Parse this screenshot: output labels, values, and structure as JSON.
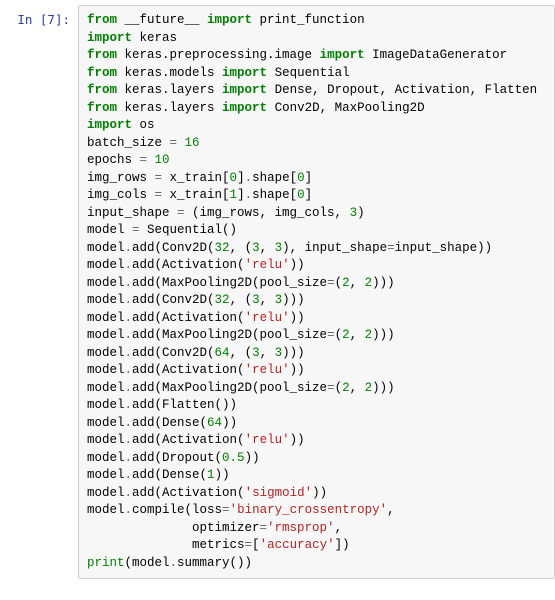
{
  "cell": {
    "prompt_label": "In [7]:",
    "code": {
      "l01a": "from",
      "l01b": " __future__ ",
      "l01c": "import",
      "l01d": " print_function",
      "l02a": "import",
      "l02b": " keras",
      "l03a": "from",
      "l03b": " keras.preprocessing.image ",
      "l03c": "import",
      "l03d": " ImageDataGenerator",
      "l04a": "from",
      "l04b": " keras.models ",
      "l04c": "import",
      "l04d": " Sequential",
      "l05a": "from",
      "l05b": " keras.layers ",
      "l05c": "import",
      "l05d": " Dense, Dropout, Activation, Flatten",
      "l06a": "from",
      "l06b": " keras.layers ",
      "l06c": "import",
      "l06d": " Conv2D, MaxPooling2D",
      "l07a": "import",
      "l07b": " os",
      "l08": "",
      "l09a": "batch_size ",
      "l09b": "=",
      "l09c": " ",
      "l09d": "16",
      "l10a": "epochs ",
      "l10b": "=",
      "l10c": " ",
      "l10d": "10",
      "l11": "",
      "l12a": "img_rows ",
      "l12b": "=",
      "l12c": " x_train[",
      "l12d": "0",
      "l12e": "]",
      "l12f": ".",
      "l12g": "shape[",
      "l12h": "0",
      "l12i": "]",
      "l13a": "img_cols ",
      "l13b": "=",
      "l13c": " x_train[",
      "l13d": "1",
      "l13e": "]",
      "l13f": ".",
      "l13g": "shape[",
      "l13h": "0",
      "l13i": "]",
      "l14a": "input_shape ",
      "l14b": "=",
      "l14c": " (img_rows, img_cols, ",
      "l14d": "3",
      "l14e": ")",
      "l15": "",
      "l16a": "model ",
      "l16b": "=",
      "l16c": " Sequential()",
      "l17a": "model",
      "l17b": ".",
      "l17c": "add(Conv2D(",
      "l17d": "32",
      "l17e": ", (",
      "l17f": "3",
      "l17g": ", ",
      "l17h": "3",
      "l17i": "), input_shape",
      "l17j": "=",
      "l17k": "input_shape))",
      "l18a": "model",
      "l18b": ".",
      "l18c": "add(Activation(",
      "l18d": "'relu'",
      "l18e": "))",
      "l19a": "model",
      "l19b": ".",
      "l19c": "add(MaxPooling2D(pool_size",
      "l19d": "=",
      "l19e": "(",
      "l19f": "2",
      "l19g": ", ",
      "l19h": "2",
      "l19i": ")))",
      "l20": "",
      "l21a": "model",
      "l21b": ".",
      "l21c": "add(Conv2D(",
      "l21d": "32",
      "l21e": ", (",
      "l21f": "3",
      "l21g": ", ",
      "l21h": "3",
      "l21i": ")))",
      "l22a": "model",
      "l22b": ".",
      "l22c": "add(Activation(",
      "l22d": "'relu'",
      "l22e": "))",
      "l23a": "model",
      "l23b": ".",
      "l23c": "add(MaxPooling2D(pool_size",
      "l23d": "=",
      "l23e": "(",
      "l23f": "2",
      "l23g": ", ",
      "l23h": "2",
      "l23i": ")))",
      "l24": "",
      "l25a": "model",
      "l25b": ".",
      "l25c": "add(Conv2D(",
      "l25d": "64",
      "l25e": ", (",
      "l25f": "3",
      "l25g": ", ",
      "l25h": "3",
      "l25i": ")))",
      "l26a": "model",
      "l26b": ".",
      "l26c": "add(Activation(",
      "l26d": "'relu'",
      "l26e": "))",
      "l27a": "model",
      "l27b": ".",
      "l27c": "add(MaxPooling2D(pool_size",
      "l27d": "=",
      "l27e": "(",
      "l27f": "2",
      "l27g": ", ",
      "l27h": "2",
      "l27i": ")))",
      "l28": "",
      "l29a": "model",
      "l29b": ".",
      "l29c": "add(Flatten())",
      "l30a": "model",
      "l30b": ".",
      "l30c": "add(Dense(",
      "l30d": "64",
      "l30e": "))",
      "l31a": "model",
      "l31b": ".",
      "l31c": "add(Activation(",
      "l31d": "'relu'",
      "l31e": "))",
      "l32a": "model",
      "l32b": ".",
      "l32c": "add(Dropout(",
      "l32d": "0.5",
      "l32e": "))",
      "l33a": "model",
      "l33b": ".",
      "l33c": "add(Dense(",
      "l33d": "1",
      "l33e": "))",
      "l34a": "model",
      "l34b": ".",
      "l34c": "add(Activation(",
      "l34d": "'sigmoid'",
      "l34e": "))",
      "l35": "",
      "l36a": "model",
      "l36b": ".",
      "l36c": "compile(loss",
      "l36d": "=",
      "l36e": "'binary_crossentropy'",
      "l36f": ",",
      "l37a": "              optimizer",
      "l37b": "=",
      "l37c": "'rmsprop'",
      "l37d": ",",
      "l38a": "              metrics",
      "l38b": "=",
      "l38c": "[",
      "l38d": "'accuracy'",
      "l38e": "])",
      "l39": "",
      "l40a": "print",
      "l40b": "(model",
      "l40c": ".",
      "l40d": "summary())"
    }
  }
}
